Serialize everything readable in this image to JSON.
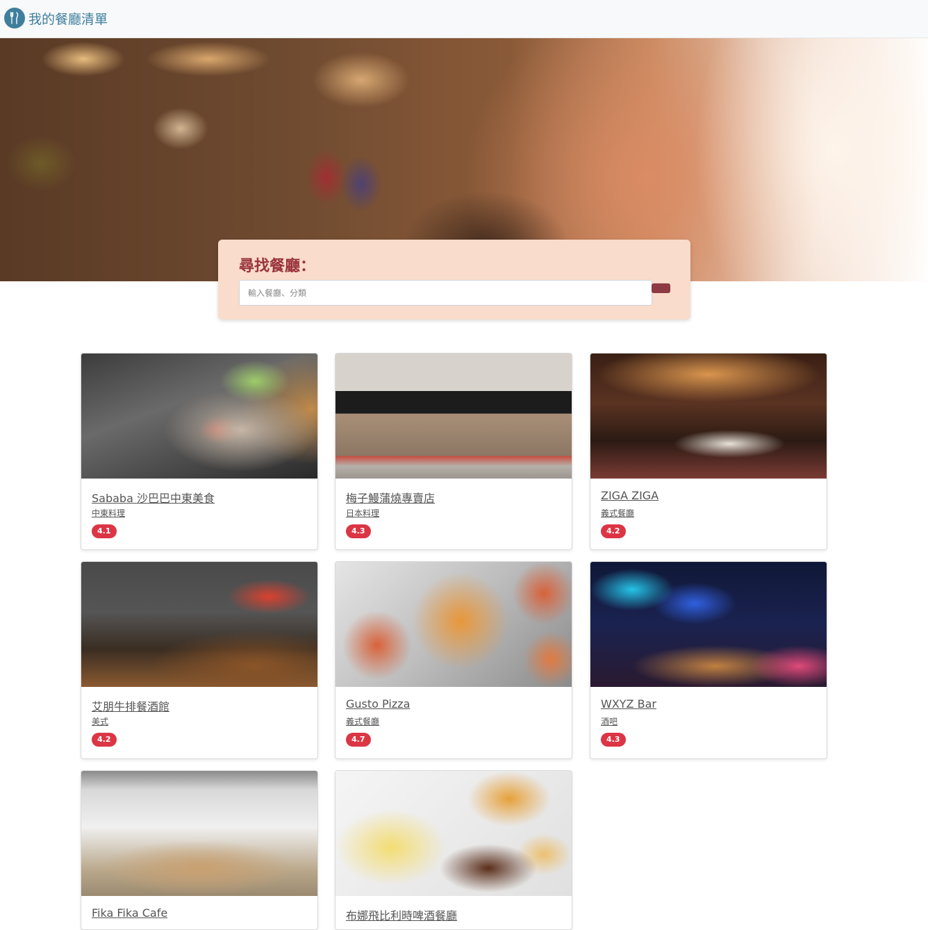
{
  "navbar": {
    "brand_icon": "utensils-icon",
    "brand_title": "我的餐廳清單",
    "brand_color": "#3f7f9c"
  },
  "search": {
    "title": "尋找餐廳：",
    "placeholder": "輸入餐廳、分類",
    "title_color": "#99343c",
    "button_color": "#8d3a43"
  },
  "restaurants": [
    {
      "name": "Sababa 沙巴巴中東美食",
      "category": "中東料理",
      "rating": "4.1"
    },
    {
      "name": "梅子鰻蒲燒專賣店",
      "category": "日本料理",
      "rating": "4.3"
    },
    {
      "name": "ZIGA ZIGA",
      "category": "義式餐廳",
      "rating": "4.2"
    },
    {
      "name": "艾朋牛排餐酒館",
      "category": "美式",
      "rating": "4.2"
    },
    {
      "name": "Gusto Pizza",
      "category": "義式餐廳",
      "rating": "4.7"
    },
    {
      "name": "WXYZ Bar",
      "category": "酒吧",
      "rating": "4.3"
    },
    {
      "name": "Fika Fika Cafe",
      "category": "",
      "rating": ""
    },
    {
      "name": "布娜飛比利時啤酒餐廳",
      "category": "",
      "rating": ""
    }
  ],
  "rating_badge_color": "#dc3545"
}
